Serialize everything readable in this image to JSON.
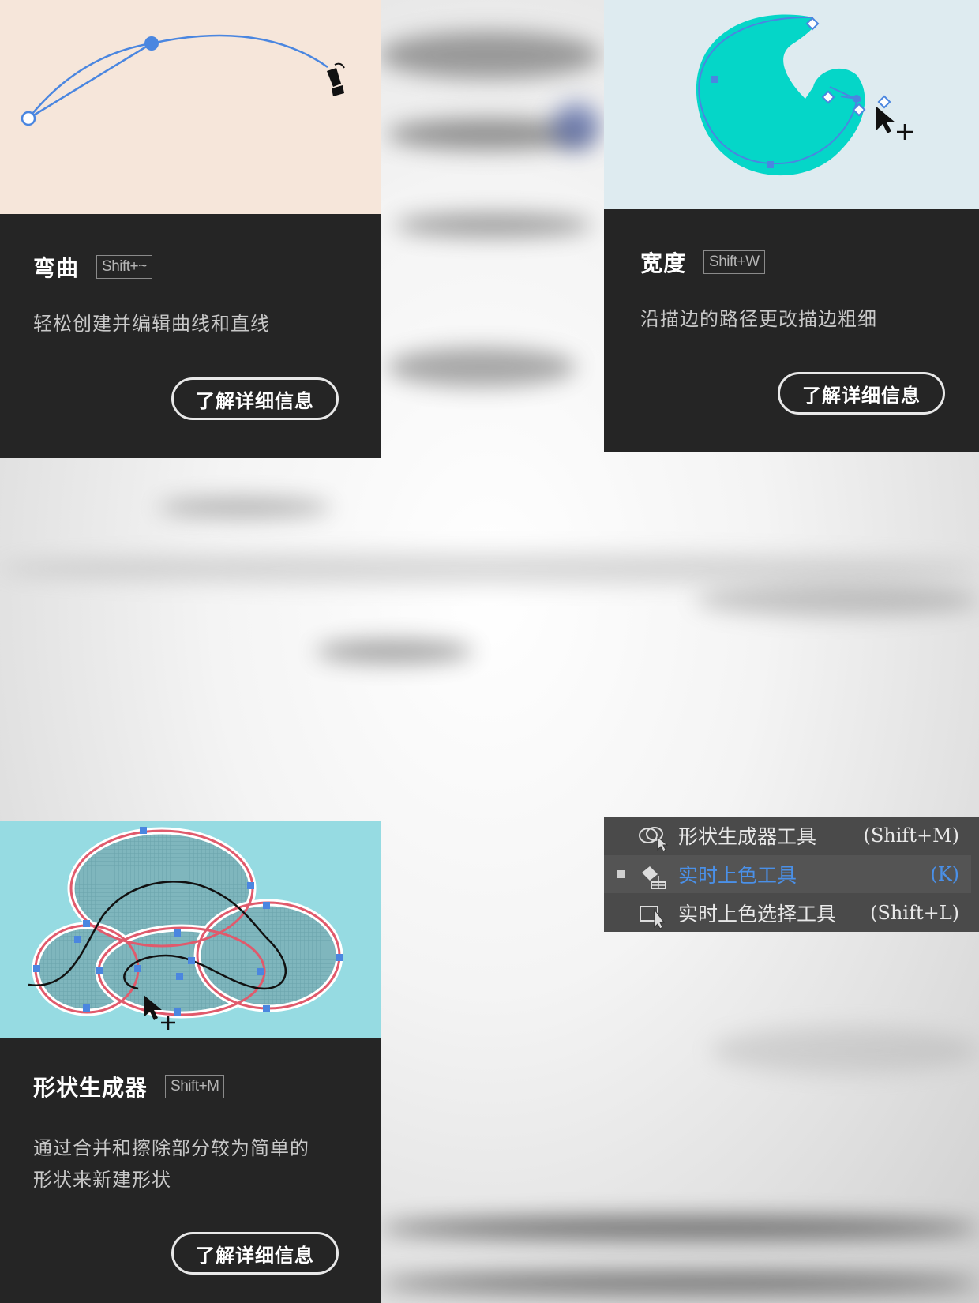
{
  "cards": [
    {
      "title": "弯曲",
      "shortcut": "Shift+~",
      "description_lines": [
        "轻松创建并编辑曲线和直线"
      ],
      "button_label": "了解详细信息",
      "illustration_bg": "#f6e6da"
    },
    {
      "title": "宽度",
      "shortcut": "Shift+W",
      "description_lines": [
        "沿描边的路径更改描边粗细"
      ],
      "button_label": "了解详细信息",
      "illustration_bg": "#deebf0"
    },
    {
      "title": "形状生成器",
      "shortcut": "Shift+M",
      "description_lines": [
        "通过合并和擦除部分较为简单的",
        "形状来新建形状"
      ],
      "button_label": "了解详细信息",
      "illustration_bg": "#96dbe2"
    }
  ],
  "tool_menu": {
    "items": [
      {
        "label": "形状生成器工具",
        "shortcut": "(Shift+M)",
        "selected": false,
        "icon": "shape-builder-icon"
      },
      {
        "label": "实时上色工具",
        "shortcut": "(K)",
        "selected": true,
        "icon": "live-paint-bucket-icon"
      },
      {
        "label": "实时上色选择工具",
        "shortcut": "(Shift+L)",
        "selected": false,
        "icon": "live-paint-selection-icon"
      }
    ],
    "selected_color": "#4a90e8"
  },
  "colors": {
    "card_bg": "#252525",
    "menu_bg": "#4a4a4a",
    "path_blue": "#4a86e0",
    "width_teal": "#05d6c8",
    "shape_red": "#e05a6c"
  }
}
